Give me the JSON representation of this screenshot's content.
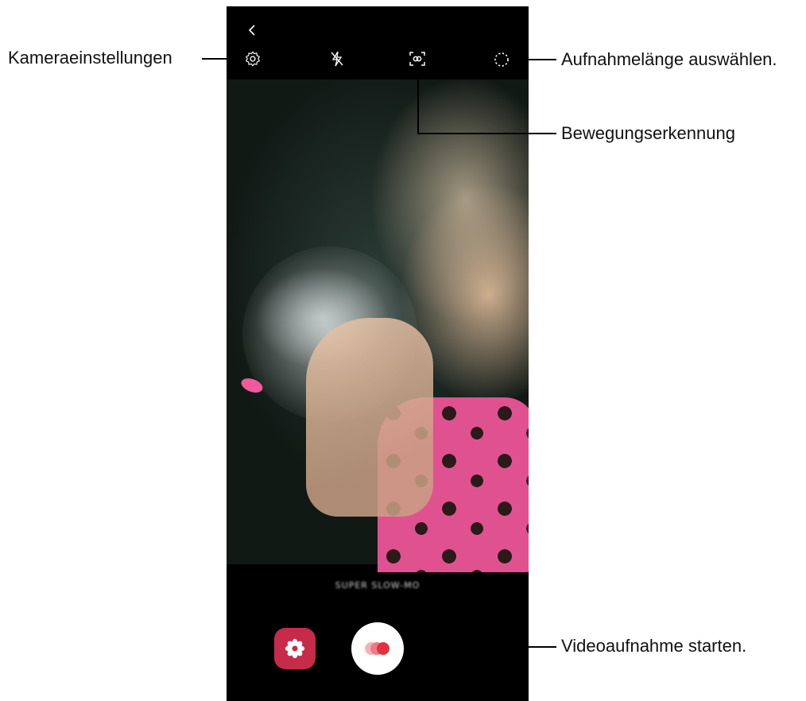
{
  "callouts": {
    "settings": "Kameraeinstellungen",
    "duration": "Aufnahmelänge auswählen.",
    "motion": "Bewegungserkennung",
    "record": "Videoaufnahme starten."
  },
  "camera": {
    "mode_label": "SUPER SLOW-MO",
    "toolbar_icons": [
      "back-icon",
      "settings-icon",
      "flash-off-icon",
      "motion-detection-icon",
      "duration-icon"
    ],
    "bottom_icons": [
      "gallery-icon",
      "record-icon"
    ],
    "colors": {
      "gallery_button": "#c72b4a",
      "record_dot": "#e0323d",
      "callout_line": "#000000"
    }
  }
}
